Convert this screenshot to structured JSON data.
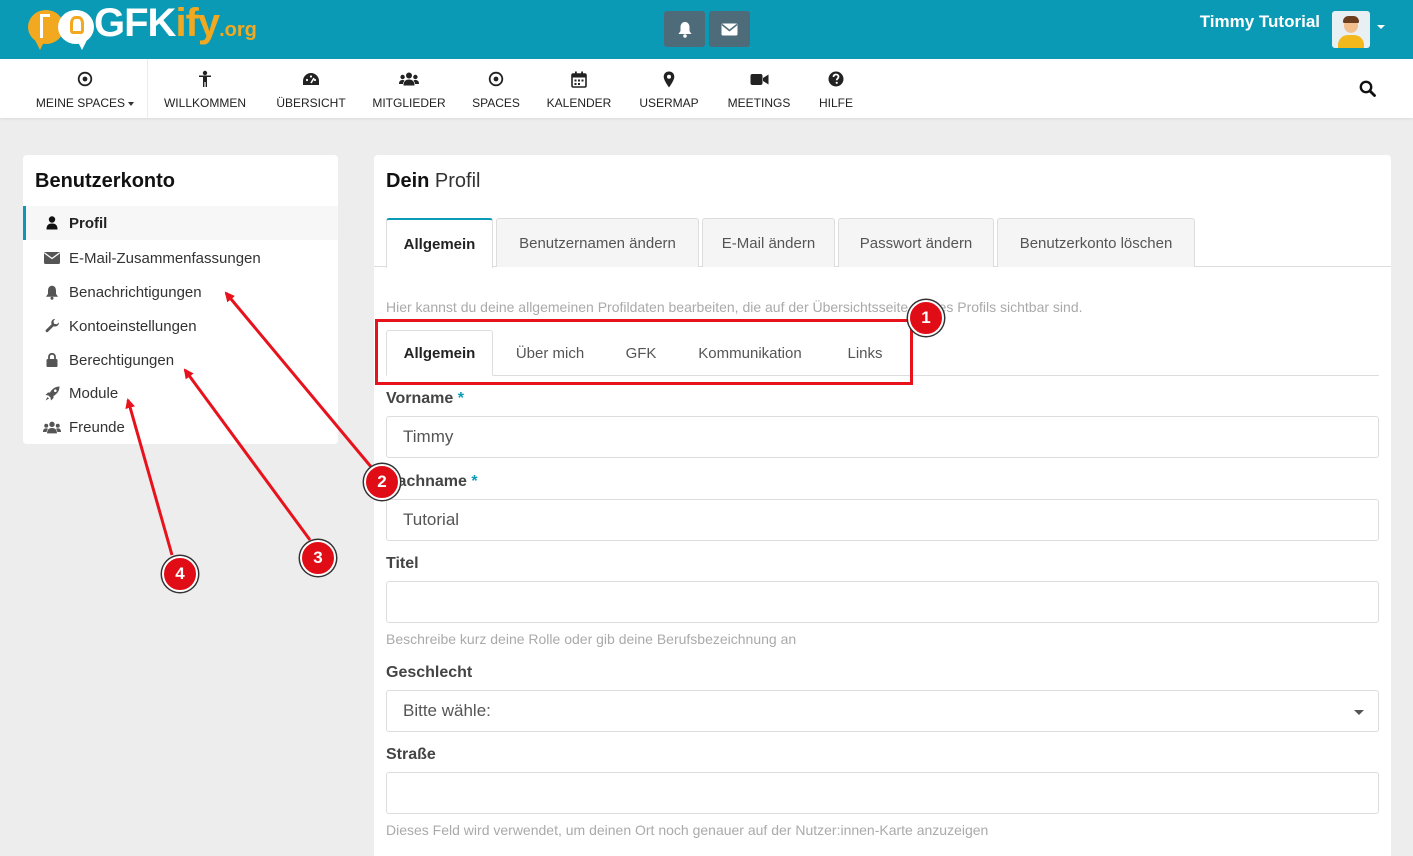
{
  "header": {
    "logo": {
      "gfk": "GFK",
      "ify": "ify",
      "org": ".org"
    },
    "user_name": "Timmy Tutorial",
    "colors": {
      "topbar": "#0b9ab5",
      "brand_orange": "#f2a91f",
      "accent": "#0b9ab5",
      "annotation_red": "#e8121c"
    }
  },
  "nav": {
    "items": [
      {
        "label": "MEINE SPACES",
        "icon": "target-icon"
      },
      {
        "label": "WILLKOMMEN",
        "icon": "person-icon"
      },
      {
        "label": "ÜBERSICHT",
        "icon": "dashboard-icon"
      },
      {
        "label": "MITGLIEDER",
        "icon": "users-icon"
      },
      {
        "label": "SPACES",
        "icon": "target-icon"
      },
      {
        "label": "KALENDER",
        "icon": "calendar-icon"
      },
      {
        "label": "USERMAP",
        "icon": "map-marker-icon"
      },
      {
        "label": "MEETINGS",
        "icon": "video-camera-icon"
      },
      {
        "label": "HILFE",
        "icon": "question-circle-icon"
      }
    ]
  },
  "sidebar": {
    "title": "Benutzerkonto",
    "items": [
      {
        "label": "Profil",
        "icon": "user-icon",
        "active": true
      },
      {
        "label": "E-Mail-Zusammenfassungen",
        "icon": "envelope-icon"
      },
      {
        "label": "Benachrichtigungen",
        "icon": "bell-icon"
      },
      {
        "label": "Kontoeinstellungen",
        "icon": "wrench-icon"
      },
      {
        "label": "Berechtigungen",
        "icon": "lock-icon"
      },
      {
        "label": "Module",
        "icon": "rocket-icon"
      },
      {
        "label": "Freunde",
        "icon": "users-icon"
      }
    ]
  },
  "main": {
    "title_bold": "Dein",
    "title_rest": "Profil",
    "tabs": [
      "Allgemein",
      "Benutzernamen ändern",
      "E-Mail ändern",
      "Passwort ändern",
      "Benutzerkonto löschen"
    ],
    "hint": "Hier kannst du deine allgemeinen Profildaten bearbeiten, die auf der Übersichtsseite deines Profils sichtbar sind.",
    "subtabs": [
      "Allgemein",
      "Über mich",
      "GFK",
      "Kommunikation",
      "Links"
    ],
    "fields": {
      "vorname": {
        "label": "Vorname",
        "required": "*",
        "value": "Timmy"
      },
      "nachname": {
        "label": "Nachname",
        "required": "*",
        "value": "Tutorial"
      },
      "titel": {
        "label": "Titel",
        "value": "",
        "help": "Beschreibe kurz deine Rolle oder gib deine Berufsbezeichnung an"
      },
      "geschlecht": {
        "label": "Geschlecht",
        "value": "Bitte wähle:"
      },
      "strasse": {
        "label": "Straße",
        "value": "",
        "help": "Dieses Feld wird verwendet, um deinen Ort noch genauer auf der Nutzer:innen-Karte anzuzeigen"
      }
    }
  },
  "annotations": {
    "badges": [
      "1",
      "2",
      "3",
      "4"
    ]
  }
}
